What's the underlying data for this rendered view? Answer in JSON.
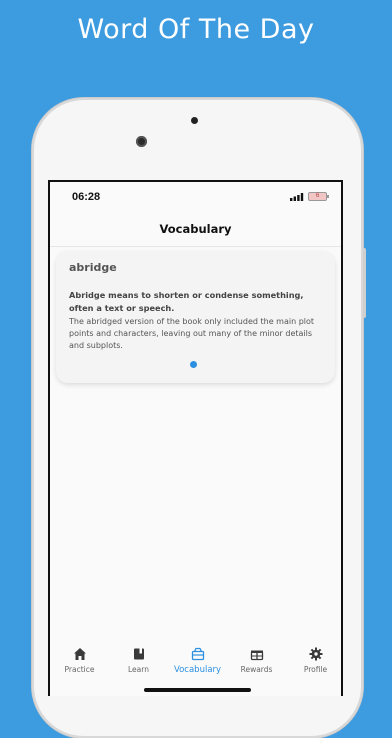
{
  "headline": "Word Of The Day",
  "status_bar": {
    "time": "06:28",
    "battery": "6"
  },
  "header": {
    "title": "Vocabulary"
  },
  "word_card": {
    "word": "abridge",
    "definition": "Abridge means to shorten or condense something, often a text or speech.",
    "example": " The abridged version of the book only included the main plot points and characters, leaving out many of the minor details and subplots."
  },
  "tabs": [
    {
      "label": "Practice",
      "icon": "home-icon",
      "active": false
    },
    {
      "label": "Learn",
      "icon": "book-icon",
      "active": false
    },
    {
      "label": "Vocabulary",
      "icon": "vocabulary-box-icon",
      "active": true
    },
    {
      "label": "Rewards",
      "icon": "gift-icon",
      "active": false
    },
    {
      "label": "Profile",
      "icon": "gear-icon",
      "active": false
    }
  ],
  "colors": {
    "background": "#3d9be0",
    "accent": "#2c8fe0",
    "inactive": "#666666"
  }
}
